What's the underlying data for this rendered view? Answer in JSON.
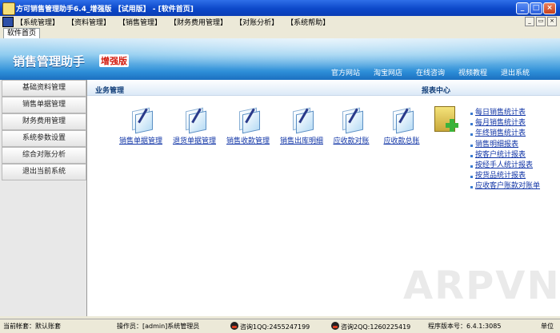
{
  "window": {
    "title": "方可销售管理助手6.4_增强版 【试用版】 - [软件首页]",
    "min_label": "_",
    "max_label": "□",
    "close_label": "×"
  },
  "menu": {
    "items": [
      "【系统管理】",
      "【资料管理】",
      "【销售管理】",
      "【财务费用管理】",
      "【对账分析】",
      "【系统帮助】"
    ],
    "mdi_min": "_",
    "mdi_restore": "▭",
    "mdi_close": "×"
  },
  "tabs": [
    "软件首页"
  ],
  "header": {
    "brand": "销售管理助手",
    "edition": "增强版",
    "links": [
      "官方网站",
      "淘宝网店",
      "在线咨询",
      "视频教程",
      "退出系统"
    ]
  },
  "sidebar": {
    "items": [
      "基础资料管理",
      "销售单据管理",
      "财务费用管理",
      "系统参数设置",
      "综合对账分析",
      "退出当前系统"
    ]
  },
  "main": {
    "business_title": "业务管理",
    "report_title": "报表中心",
    "functions": [
      "销售单据管理",
      "退货单据管理",
      "销售收款管理",
      "销售出库明细",
      "应收款对账",
      "应收款总账"
    ],
    "reports": [
      "每日销售统计表",
      "每月销售统计表",
      "年终销售统计表",
      "销售明细报表",
      "按客户统计报表",
      "按经手人统计报表",
      "按货品统计报表",
      "应收客户账款对账单"
    ]
  },
  "status": {
    "account": "当前帐套：默认账套",
    "operator": "操作员：[admin]系统管理员",
    "qq1": "咨询1QQ:2455247199",
    "qq2": "咨询2QQ:1260225419",
    "version": "程序版本号：6.4.1:3085",
    "unit": "单位"
  },
  "watermark": "ARPVN",
  "colors": {
    "titlebar": "#0c48c9",
    "banner": "#2e8fd8",
    "link": "#1034a6",
    "edition_red": "#d41d10"
  }
}
